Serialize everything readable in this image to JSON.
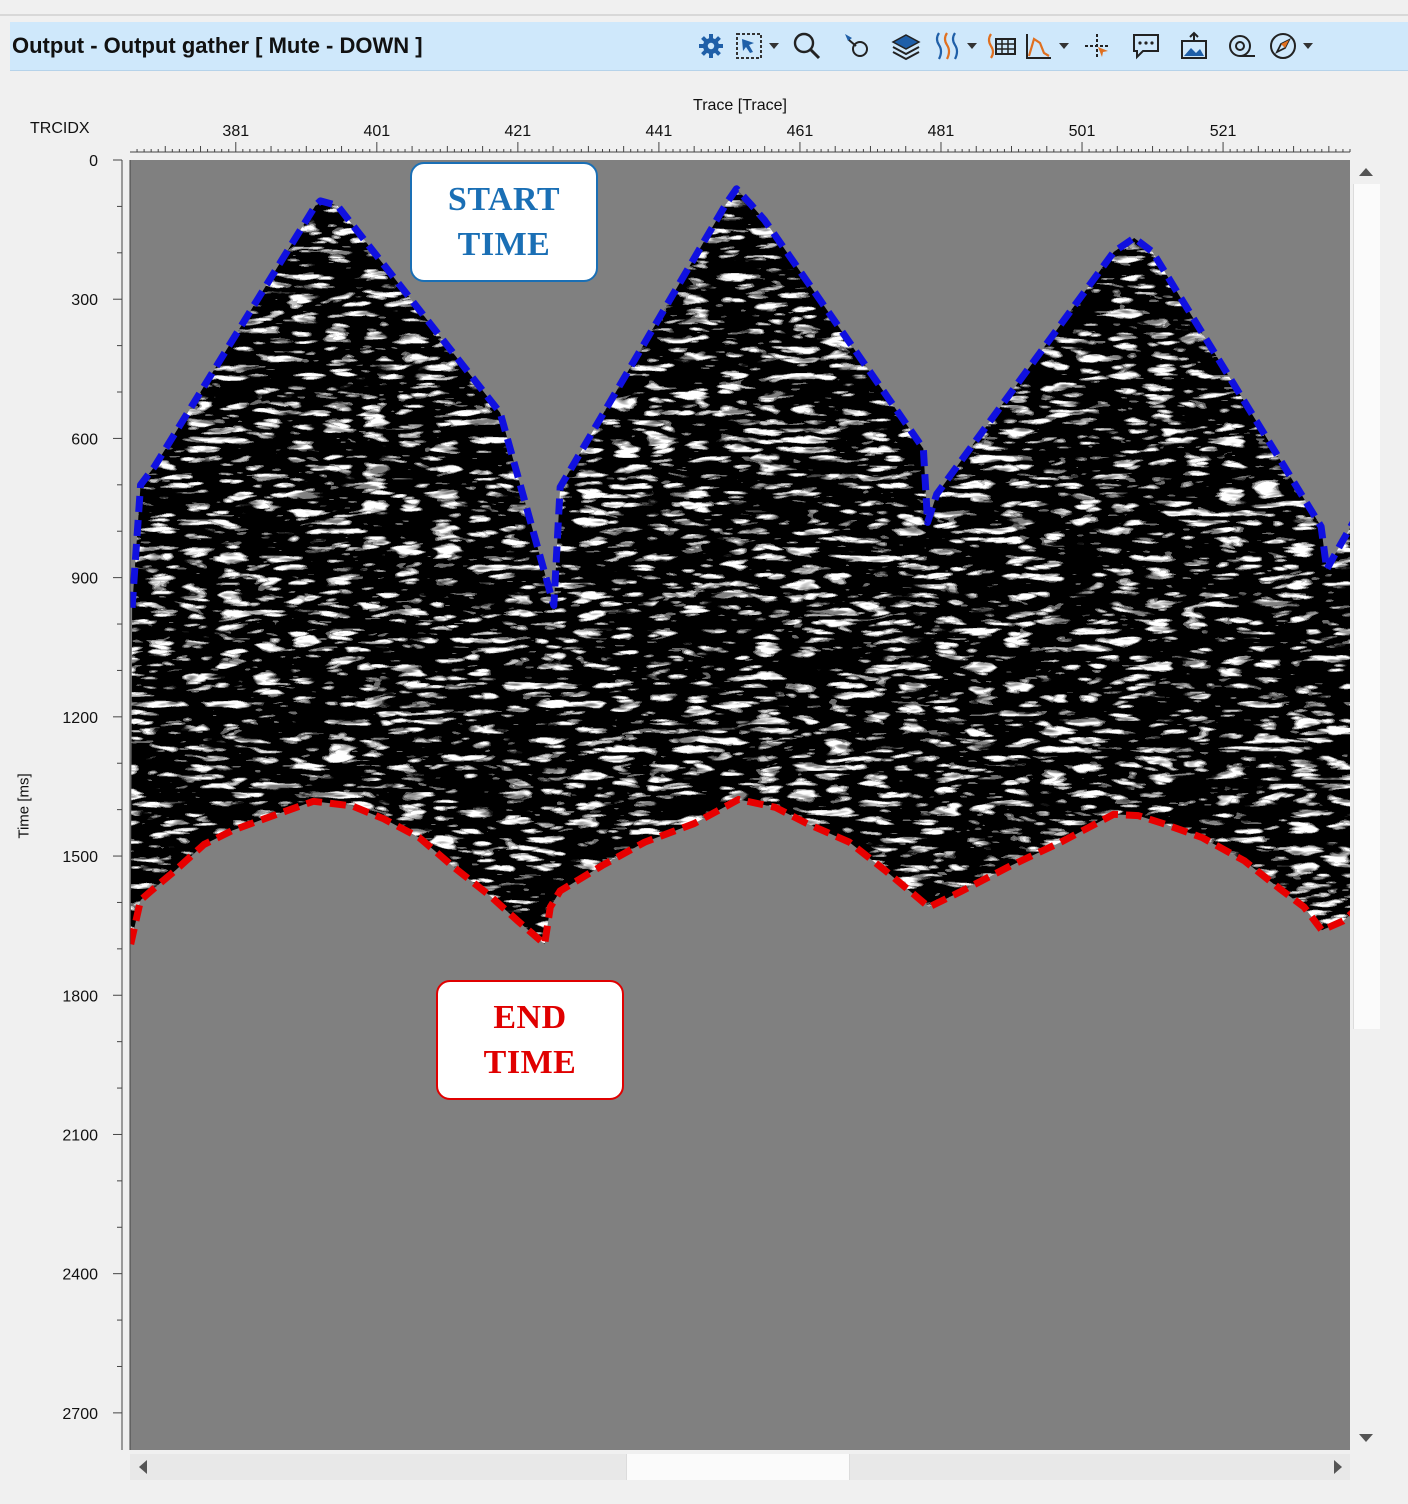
{
  "window": {
    "title": "Output - Output gather [ Mute - DOWN ]"
  },
  "toolbar": {
    "icons": [
      "gear-icon",
      "select-area-icon",
      "zoom-icon",
      "pick-icon",
      "layers-icon",
      "wiggle-icon",
      "table-icon",
      "histogram-icon",
      "crosshair-icon",
      "comment-icon",
      "export-image-icon",
      "tape-icon",
      "compass-icon"
    ],
    "accent_blue": "#1f5fa8",
    "accent_orange": "#e07020"
  },
  "plot": {
    "x_axis_title": "Trace [Trace]",
    "x_key_label": "TRCIDX",
    "y_axis_title": "Time [ms]",
    "x_ticks": [
      "381",
      "401",
      "421",
      "441",
      "461",
      "481",
      "501",
      "521"
    ],
    "y_ticks": [
      "0",
      "300",
      "600",
      "900",
      "1200",
      "1500",
      "1800",
      "2100",
      "2400",
      "2700"
    ],
    "background_color": "#808080"
  },
  "chart_data": {
    "type": "line",
    "x_axis": "TRCIDX",
    "y_axis": "Time [ms]",
    "y_inverted": true,
    "xlim": [
      366,
      539
    ],
    "ylim": [
      0,
      2780
    ],
    "series": [
      {
        "color": "#1010e0",
        "x": [
          366.3,
          367.5,
          369.5,
          392.3,
          393,
          395.4,
          397.3,
          418.5,
          425.8,
          426.1,
          427,
          450.5,
          452,
          454,
          456,
          478.5,
          479.1,
          480.4,
          505.5,
          508.4,
          511,
          534.9,
          535.7,
          537.6,
          539.5
        ],
        "y": [
          965,
          700,
          660,
          98,
          88,
          98,
          135,
          545,
          944,
          960,
          705,
          95,
          62,
          95,
          130,
          622,
          781,
          720,
          198,
          168,
          198,
          790,
          882,
          830,
          780
        ]
      },
      {
        "color": "#e80000",
        "x": [
          366.1,
          367.5,
          369,
          372.5,
          376.5,
          380.5,
          385,
          392,
          397.5,
          402,
          407,
          412,
          417,
          421,
          424.8,
          425.6,
          427,
          433,
          439,
          446,
          452.3,
          457.5,
          462,
          468,
          473,
          479.3,
          484,
          491,
          498,
          505.5,
          509,
          512.5,
          518,
          524,
          529,
          532.5,
          535,
          538,
          539.5
        ],
        "y": [
          1690,
          1595,
          1575,
          1530,
          1475,
          1445,
          1420,
          1382,
          1392,
          1420,
          1460,
          1525,
          1585,
          1640,
          1690,
          1610,
          1575,
          1520,
          1470,
          1430,
          1378,
          1395,
          1430,
          1470,
          1530,
          1610,
          1575,
          1520,
          1470,
          1410,
          1413,
          1430,
          1460,
          1510,
          1570,
          1610,
          1660,
          1640,
          1620
        ]
      }
    ]
  },
  "annotations": {
    "start_label_line1": "START",
    "start_label_line2": "TIME",
    "start_color": "#1a6fb5",
    "end_label_line1": "END",
    "end_label_line2": "TIME",
    "end_color": "#e00000"
  }
}
